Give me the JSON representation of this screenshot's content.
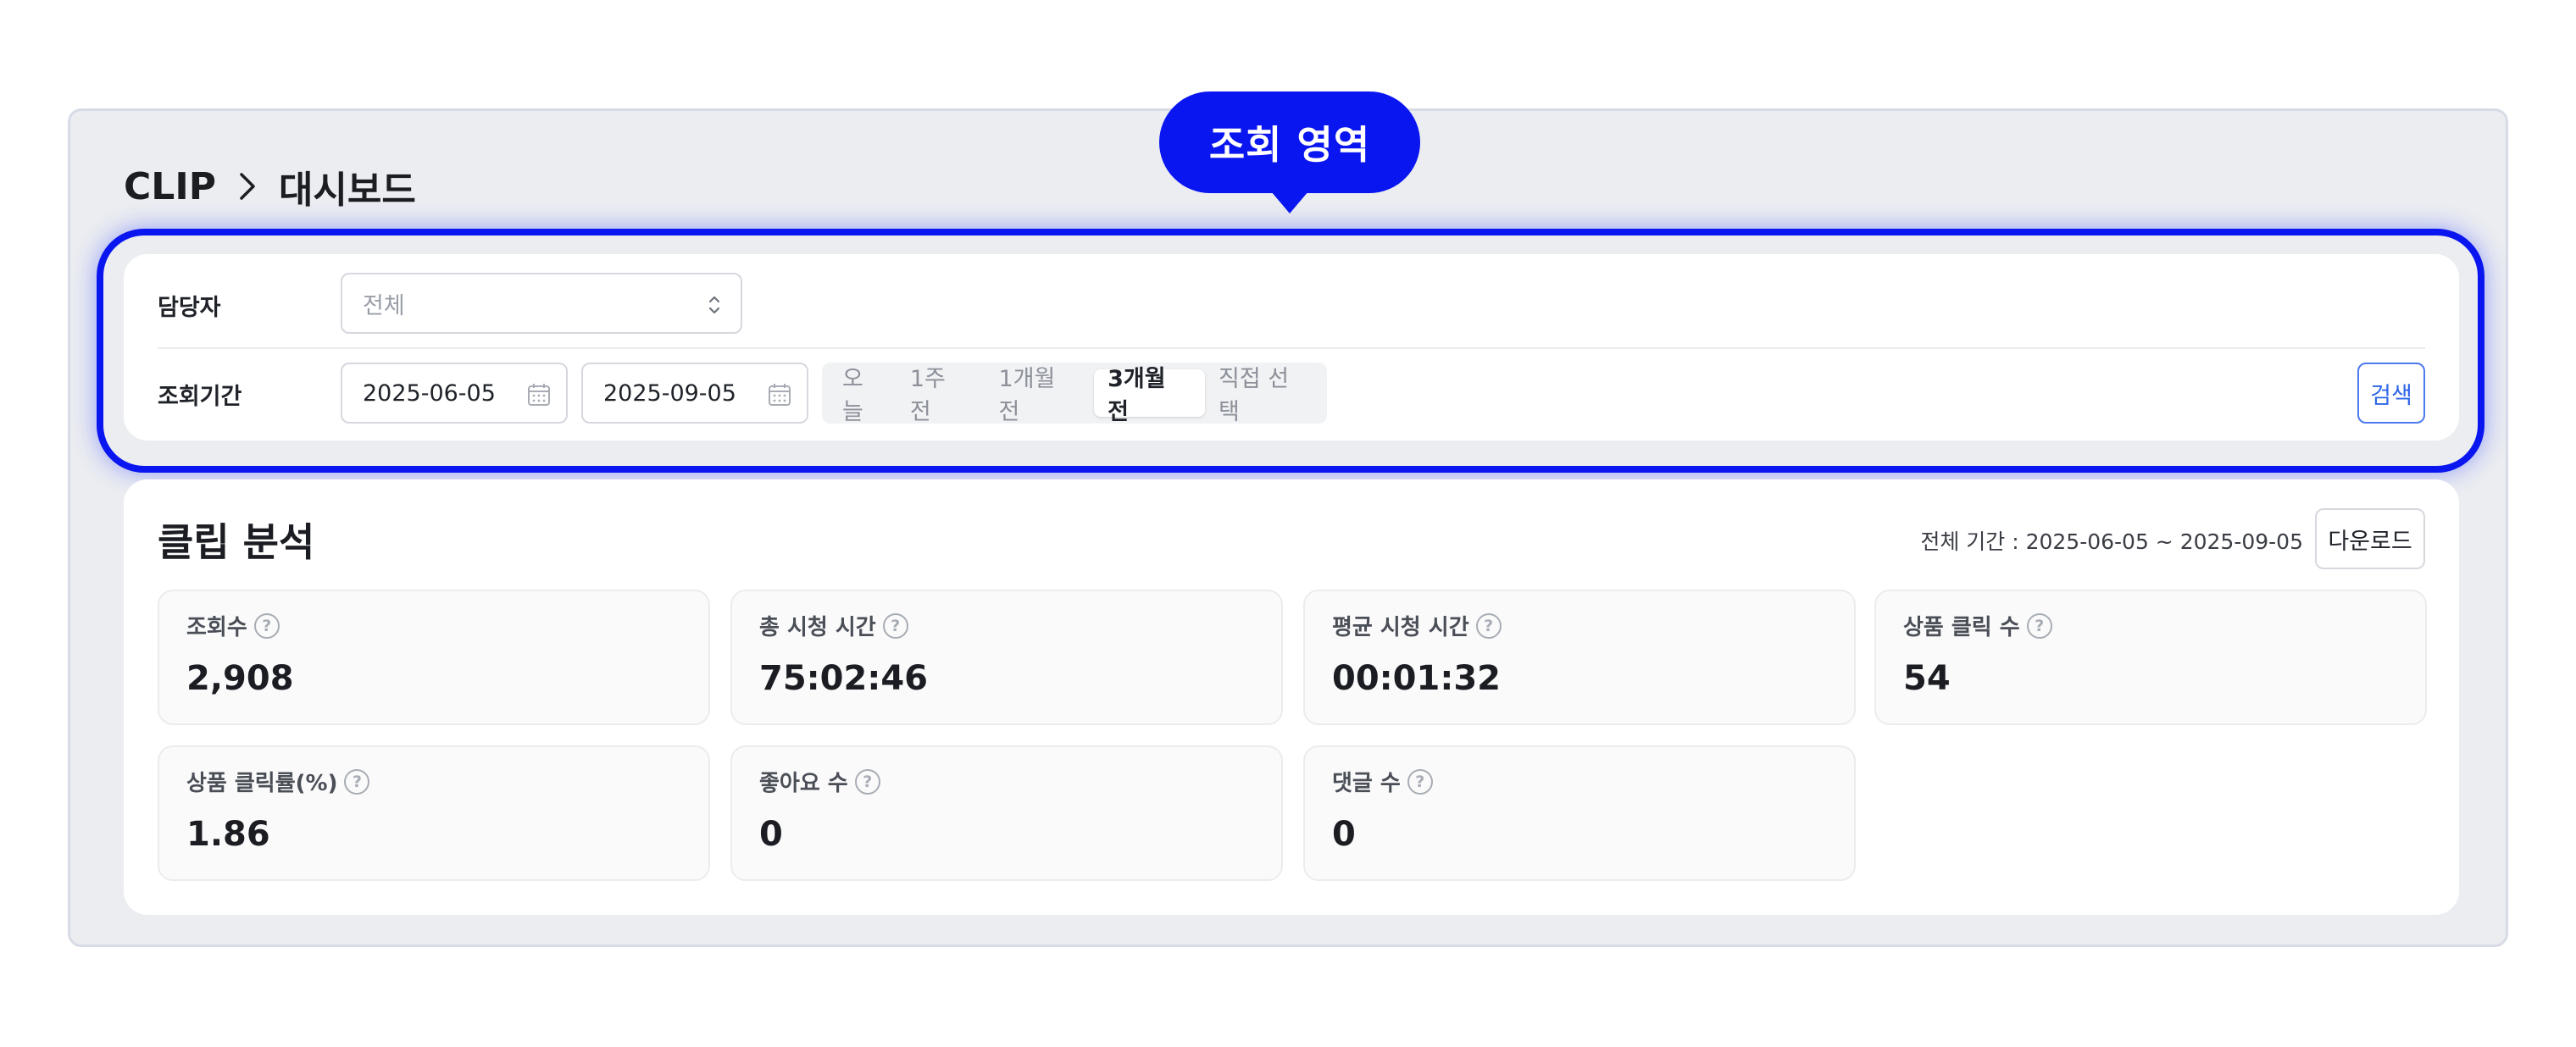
{
  "breadcrumb": {
    "root": "CLIP",
    "current": "대시보드"
  },
  "tooltip": {
    "label": "조회 영역"
  },
  "filters": {
    "manager_label": "담당자",
    "manager_value": "전체",
    "period_label": "조회기간",
    "start_date": "2025-06-05",
    "end_date": "2025-09-05",
    "quick_ranges": [
      "오늘",
      "1주 전",
      "1개월 전",
      "3개월 전",
      "직접 선택"
    ],
    "selected_range": "3개월 전",
    "search_label": "검색"
  },
  "analysis": {
    "title": "클립 분석",
    "period_text": "전체 기간 : 2025-06-05 ~ 2025-09-05",
    "download_label": "다운로드",
    "metrics": [
      {
        "label": "조회수",
        "value": "2,908"
      },
      {
        "label": "총 시청 시간",
        "value": "75:02:46"
      },
      {
        "label": "평균 시청 시간",
        "value": "00:01:32"
      },
      {
        "label": "상품 클릭 수",
        "value": "54"
      },
      {
        "label": "상품 클릭률(%)",
        "value": "1.86"
      },
      {
        "label": "좋아요 수",
        "value": "0"
      },
      {
        "label": "댓글 수",
        "value": "0"
      }
    ]
  },
  "colors": {
    "accent": "#0a16ef",
    "link_blue": "#2f66e8",
    "background": "#ebedf1"
  },
  "icons": {
    "separator": "chevron-right-icon",
    "select": "chevron-up-down-icon",
    "date": "calendar-icon",
    "help": "help-circle-icon"
  }
}
